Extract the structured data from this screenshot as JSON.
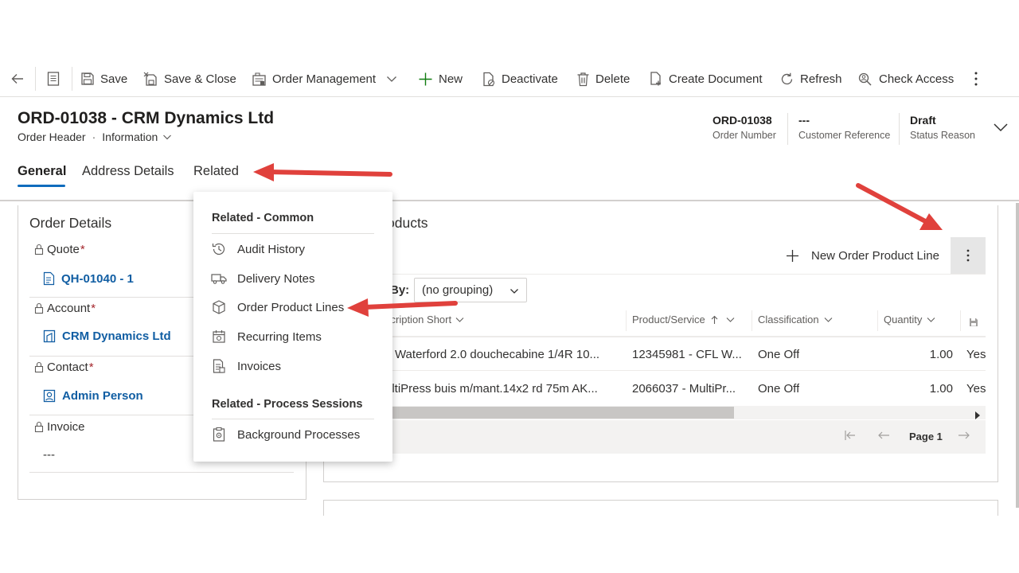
{
  "toolbar": {
    "save": "Save",
    "save_close": "Save & Close",
    "order_management": "Order Management",
    "new": "New",
    "deactivate": "Deactivate",
    "delete": "Delete",
    "create_document": "Create Document",
    "refresh": "Refresh",
    "check_access": "Check Access"
  },
  "header": {
    "title": "ORD-01038 - CRM Dynamics Ltd",
    "entity": "Order Header",
    "form": "Information",
    "fields": [
      {
        "value": "ORD-01038",
        "label": "Order Number"
      },
      {
        "value": "---",
        "label": "Customer Reference"
      },
      {
        "value": "Draft",
        "label": "Status Reason"
      }
    ]
  },
  "tabs": [
    "General",
    "Address Details",
    "Related"
  ],
  "order_details": {
    "title": "Order Details",
    "fields": [
      {
        "label": "Quote",
        "value": "QH-01040 - 1",
        "icon": "quote-doc-icon"
      },
      {
        "label": "Account",
        "value": "CRM Dynamics Ltd",
        "icon": "account-icon"
      },
      {
        "label": "Contact",
        "value": "Admin Person",
        "icon": "contact-icon"
      },
      {
        "label": "Invoice",
        "value": "---"
      }
    ],
    "required_mark": "*"
  },
  "products": {
    "title_partial": "oducts",
    "new_line": "New Order Product Line",
    "group_by_label": "By:",
    "group_by_value": "(no grouping)",
    "columns": [
      "scription Short",
      "Product/Service",
      "Classification",
      "Quantity"
    ],
    "rows": [
      [
        "L Waterford 2.0 douchecabine 1/4R 10...",
        "12345981 - CFL W...",
        "One Off",
        "1.00",
        "Yes"
      ],
      [
        "ultiPress buis m/mant.14x2 rd 75m AK...",
        "2066037 - MultiPr...",
        "One Off",
        "1.00",
        "Yes"
      ]
    ],
    "page": "Page 1"
  },
  "related_menu": {
    "common_header": "Related - Common",
    "common_items": [
      {
        "label": "Audit History",
        "icon": "history-icon"
      },
      {
        "label": "Delivery Notes",
        "icon": "truck-icon"
      },
      {
        "label": "Order Product Lines",
        "icon": "box-icon"
      },
      {
        "label": "Recurring Items",
        "icon": "calendar-icon"
      },
      {
        "label": "Invoices",
        "icon": "invoice-icon"
      }
    ],
    "process_header": "Related - Process Sessions",
    "process_items": [
      {
        "label": "Background Processes",
        "icon": "background-process-icon"
      }
    ]
  },
  "colors": {
    "accent": "#0f6cbd",
    "link": "#115ea3",
    "annotation_arrow": "#e0413c",
    "required": "#a4262c"
  }
}
